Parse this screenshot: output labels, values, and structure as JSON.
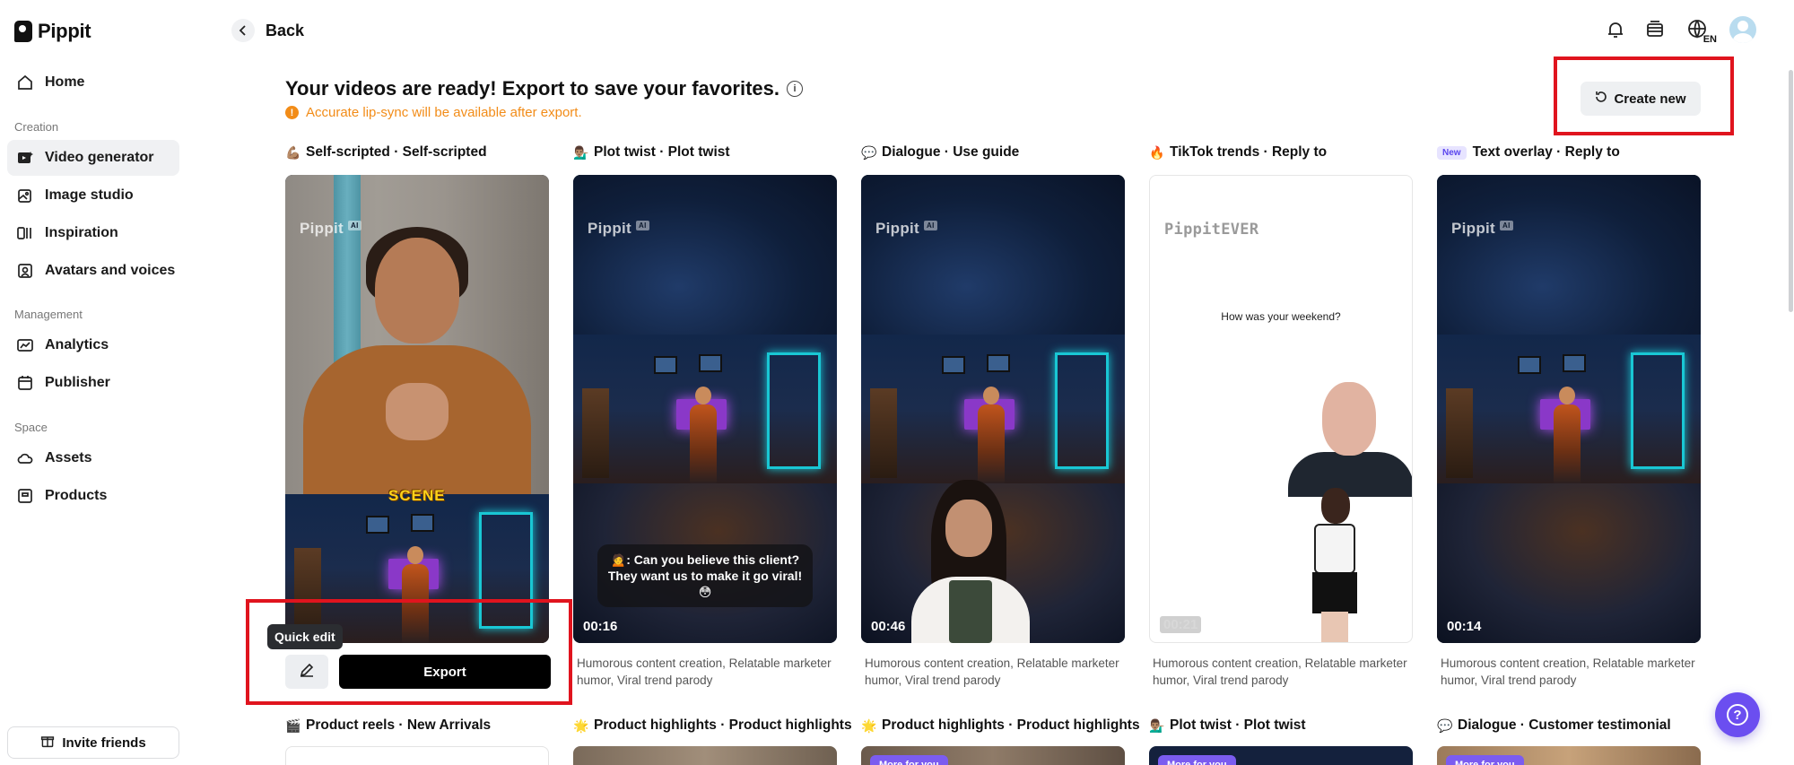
{
  "app": {
    "name": "Pippit"
  },
  "sidebar": {
    "items": [
      {
        "label": "Home",
        "icon": "home-icon"
      },
      {
        "label": "Video generator",
        "icon": "video-generator-icon",
        "active": true
      },
      {
        "label": "Image studio",
        "icon": "image-studio-icon"
      },
      {
        "label": "Inspiration",
        "icon": "inspiration-icon"
      },
      {
        "label": "Avatars and voices",
        "icon": "avatar-voice-icon"
      },
      {
        "label": "Analytics",
        "icon": "analytics-icon"
      },
      {
        "label": "Publisher",
        "icon": "calendar-icon"
      },
      {
        "label": "Assets",
        "icon": "cloud-icon"
      },
      {
        "label": "Products",
        "icon": "product-box-icon"
      }
    ],
    "sections": {
      "creation": "Creation",
      "management": "Management",
      "space": "Space"
    },
    "invite_label": "Invite friends"
  },
  "topbar": {
    "back_label": "Back",
    "language": "EN",
    "icons": [
      "bell-icon",
      "subscription-icon",
      "language-globe-icon",
      "user-avatar"
    ]
  },
  "header": {
    "title": "Your videos are ready! Export to save your favorites.",
    "notice": "Accurate lip-sync will be available after export.",
    "create_label": "Create new"
  },
  "cards": [
    {
      "emoji": "💪🏽",
      "title": "Self-scripted · Self-scripted",
      "desc": "",
      "duration": "",
      "overlay": "SCENE",
      "watermark": "Pippit"
    },
    {
      "emoji": "💁🏽‍♂️",
      "title": "Plot twist · Plot twist",
      "desc": "Humorous content creation, Relatable marketer humor, Viral trend parody",
      "duration": "00:16",
      "caption": "🙍: Can you believe this client? They want us to make it go viral! 😳",
      "watermark": "Pippit"
    },
    {
      "emoji": "💬",
      "title": "Dialogue · Use guide",
      "desc": "Humorous content creation, Relatable marketer humor, Viral trend parody",
      "duration": "00:46",
      "watermark": "Pippit"
    },
    {
      "emoji": "🔥",
      "title": "TikTok trends · Reply to",
      "desc": "Humorous content creation, Relatable marketer humor, Viral trend parody",
      "duration": "00:21",
      "question": "How was your weekend?",
      "watermark": "PippitEVER"
    },
    {
      "badge": "New",
      "title": "Text overlay · Reply to",
      "desc": "Humorous content creation, Relatable marketer humor, Viral trend parody",
      "duration": "00:14",
      "watermark": "Pippit"
    }
  ],
  "watermark_ai": "AI",
  "card_actions": {
    "tooltip": "Quick edit",
    "export_label": "Export"
  },
  "row2": [
    {
      "emoji": "🎬",
      "title": "Product reels · New Arrivals"
    },
    {
      "emoji": "🌟",
      "title": "Product highlights · Product highlights"
    },
    {
      "emoji": "🌟",
      "title": "Product highlights · Product highlights"
    },
    {
      "emoji": "💁🏽‍♂️",
      "title": "Plot twist · Plot twist"
    },
    {
      "emoji": "💬",
      "title": "Dialogue · Customer testimonial"
    }
  ],
  "row2_chip": "More for you",
  "colors": {
    "accent": "#6b4ef0",
    "warning": "#f28c18",
    "highlight_box": "#e0141e"
  }
}
